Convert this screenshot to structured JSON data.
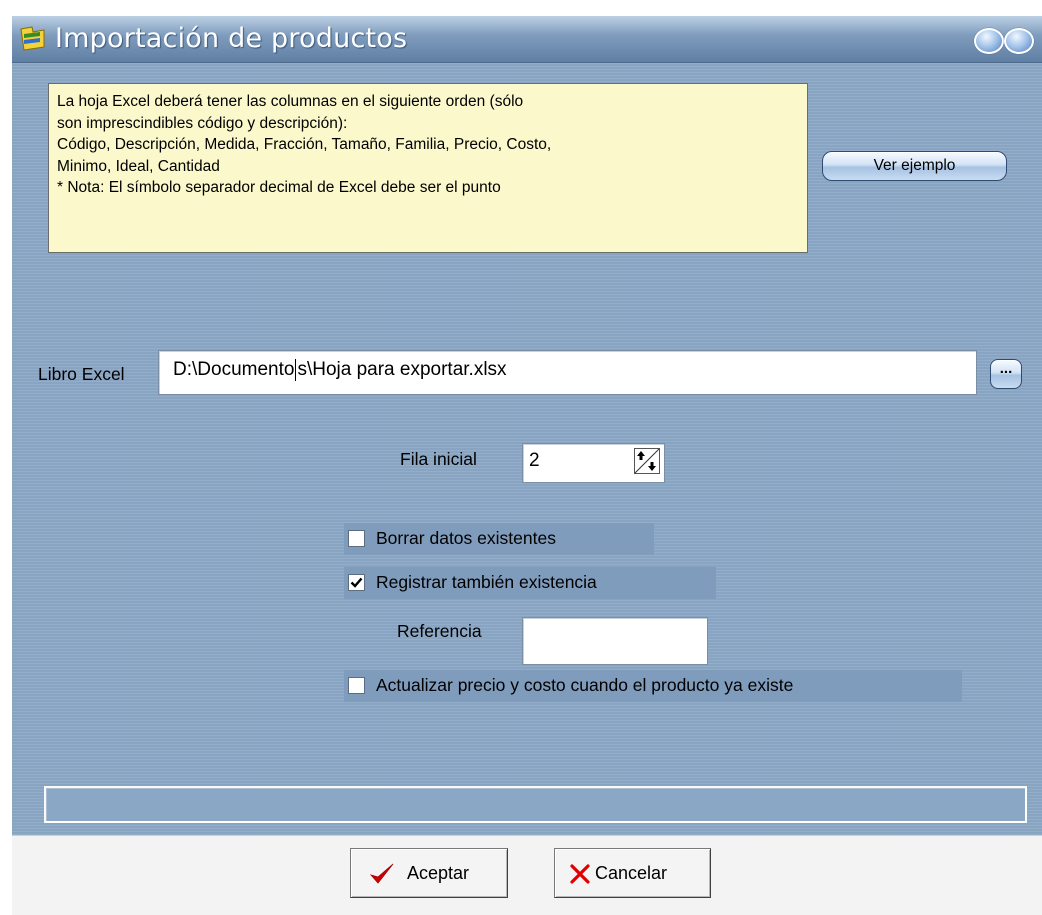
{
  "window": {
    "title": "Importación de productos"
  },
  "note": {
    "lines": [
      "La hoja Excel deberá tener las columnas en el siguiente orden (sólo",
      "son imprescindibles código y descripción):",
      "Código, Descripción, Medida, Fracción, Tamaño, Familia, Precio, Costo,",
      "Minimo, Ideal, Cantidad",
      " * Nota: El símbolo separador decimal de Excel debe ser el punto"
    ]
  },
  "ver_ejemplo_label": "Ver ejemplo",
  "libro_excel": {
    "label": "Libro Excel",
    "value_before_caret": "D:\\Documento",
    "value_after_caret": "s\\Hoja para exportar.xlsx",
    "browse_label": "..."
  },
  "fila_inicial": {
    "label": "Fila inicial",
    "value": "2"
  },
  "options": {
    "borrar": {
      "label": "Borrar datos existentes",
      "checked": false
    },
    "registrar": {
      "label": "Registrar también existencia",
      "checked": true
    },
    "actualizar": {
      "label": "Actualizar precio y costo cuando el producto ya existe",
      "checked": false
    }
  },
  "referencia": {
    "label": "Referencia",
    "value": ""
  },
  "buttons": {
    "aceptar": "Aceptar",
    "cancelar": "Cancelar"
  },
  "colors": {
    "background": "#8ba8c6",
    "note_bg": "#fbf8cb",
    "accept_icon": "#d40000",
    "cancel_icon": "#e00000"
  },
  "icons": {
    "title": "app-icon",
    "window_buttons": [
      "minimize-icon",
      "close-icon"
    ],
    "accept": "checkmark-icon",
    "cancel": "x-icon",
    "spin": "spin-arrows-icon"
  }
}
